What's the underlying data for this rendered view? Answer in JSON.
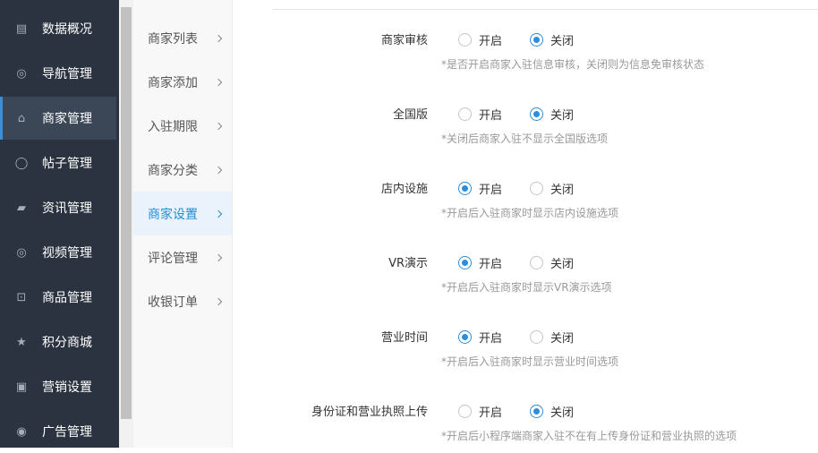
{
  "sidebar": {
    "items": [
      {
        "label": "数据概况",
        "icon": "dashboard-icon",
        "glyph": "▤"
      },
      {
        "label": "导航管理",
        "icon": "compass-icon",
        "glyph": "◎"
      },
      {
        "label": "商家管理",
        "icon": "bank-icon",
        "glyph": "⌂",
        "active": true
      },
      {
        "label": "帖子管理",
        "icon": "comment-icon",
        "glyph": "◯"
      },
      {
        "label": "资讯管理",
        "icon": "book-icon",
        "glyph": "▰"
      },
      {
        "label": "视频管理",
        "icon": "video-icon",
        "glyph": "◎"
      },
      {
        "label": "商品管理",
        "icon": "cart-icon",
        "glyph": "⊡"
      },
      {
        "label": "积分商城",
        "icon": "star-icon",
        "glyph": "★"
      },
      {
        "label": "营销设置",
        "icon": "gift-icon",
        "glyph": "▣"
      },
      {
        "label": "广告管理",
        "icon": "lifebuoy-icon",
        "glyph": "◉"
      }
    ]
  },
  "submenu": {
    "items": [
      {
        "label": "商家列表"
      },
      {
        "label": "商家添加"
      },
      {
        "label": "入驻期限"
      },
      {
        "label": "商家分类"
      },
      {
        "label": "商家设置",
        "active": true
      },
      {
        "label": "评论管理"
      },
      {
        "label": "收银订单"
      }
    ]
  },
  "settings": {
    "on_label": "开启",
    "off_label": "关闭",
    "rows": [
      {
        "label": "商家审核",
        "value": "off",
        "hint": "*是否开启商家入驻信息审核，关闭则为信息免审核状态"
      },
      {
        "label": "全国版",
        "value": "off",
        "hint": "*关闭后商家入驻不显示全国版选项"
      },
      {
        "label": "店内设施",
        "value": "on",
        "hint": "*开启后入驻商家时显示店内设施选项"
      },
      {
        "label": "VR演示",
        "value": "on",
        "hint": "*开启后入驻商家时显示VR演示选项"
      },
      {
        "label": "营业时间",
        "value": "on",
        "hint": "*开启后入驻商家时显示营业时间选项"
      },
      {
        "label": "身份证和营业执照上传",
        "value": "off",
        "hint": "*开启后小程序端商家入驻不在有上传身份证和营业执照的选项"
      }
    ]
  }
}
